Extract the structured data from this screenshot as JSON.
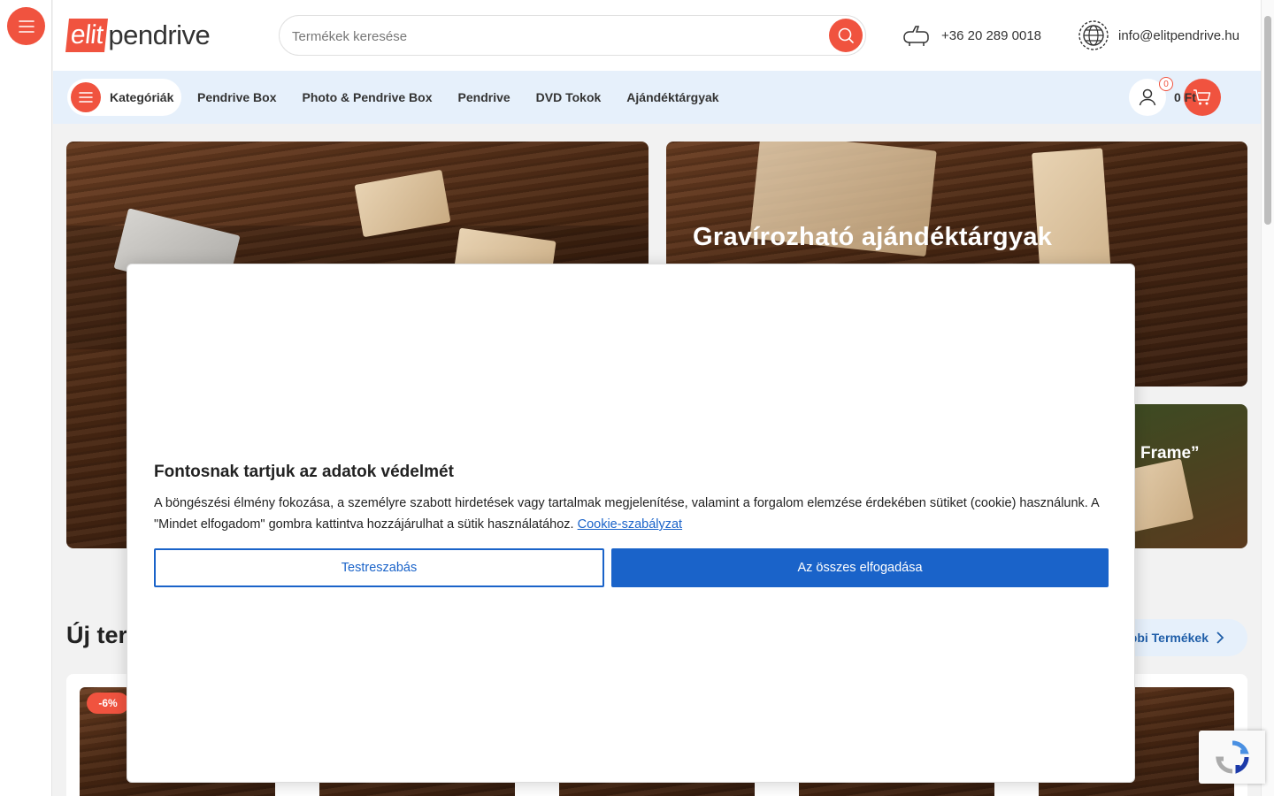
{
  "header": {
    "logo_part1": "elit",
    "logo_part2": "pendrive",
    "search_placeholder": "Termékek keresése",
    "phone": "+36 20 289 0018",
    "email": "info@elitpendrive.hu"
  },
  "nav": {
    "categories_label": "Kategóriák",
    "links": [
      "Pendrive Box",
      "Photo & Pendrive Box",
      "Pendrive",
      "DVD Tokok",
      "Ajándéktárgyak"
    ],
    "cart_count": "0",
    "cart_total": "0 Ft"
  },
  "banners": {
    "right_top_title": "Gravírozható ajándéktárgyak",
    "right_bottom_title": "Frame”"
  },
  "section": {
    "title": "Új ter",
    "more_label": "bbi Termékek",
    "discount_badge": "-6%"
  },
  "cookie": {
    "title": "Fontosnak tartjuk az adatok védelmét",
    "text": "A böngészési élmény fokozása, a személyre szabott hirdetések vagy tartalmak megjelenítése, valamint a forgalom elemzése érdekében sütiket (cookie) használunk. A \"Mindet elfogadom\" gombra kattintva hozzájárulhat a sütik használatához.",
    "policy_link": "Cookie-szabályzat",
    "customize_label": "Testreszabás",
    "accept_label": "Az összes elfogadása"
  },
  "colors": {
    "brand": "#f0533f",
    "nav_bg": "#e6f0fb",
    "primary_blue": "#1a63c9"
  }
}
